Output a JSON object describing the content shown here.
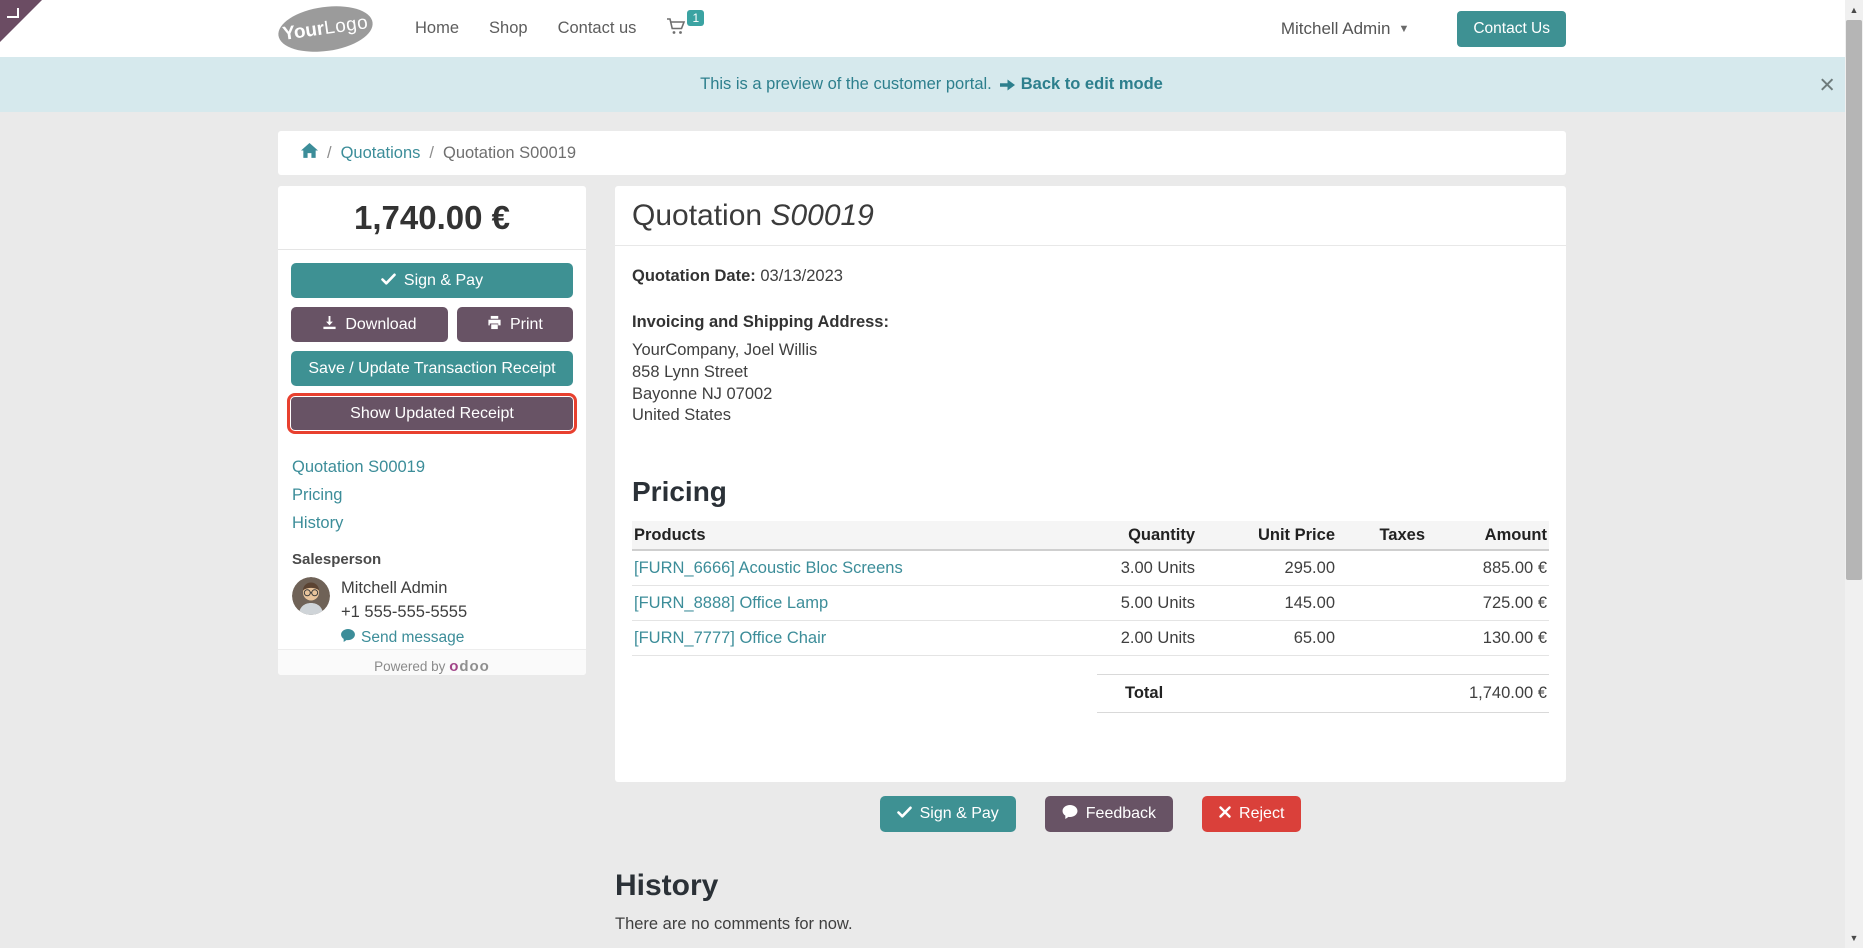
{
  "header": {
    "logo": {
      "bold": "Your",
      "light": "Logo"
    },
    "nav": [
      {
        "label": "Home"
      },
      {
        "label": "Shop"
      },
      {
        "label": "Contact us"
      }
    ],
    "cart_count": "1",
    "user_name": "Mitchell Admin",
    "contact_us": "Contact Us"
  },
  "banner": {
    "message": "This is a preview of the customer portal.",
    "link": "Back to edit mode",
    "close": "×"
  },
  "breadcrumb": {
    "parent": "Quotations",
    "current": "Quotation S00019"
  },
  "sidebar": {
    "amount": "1,740.00 €",
    "buttons": {
      "sign_pay": "Sign & Pay",
      "download": "Download",
      "print": "Print",
      "save_receipt": "Save / Update Transaction Receipt",
      "show_receipt": "Show Updated Receipt"
    },
    "links": [
      {
        "label": "Quotation S00019"
      },
      {
        "label": "Pricing"
      },
      {
        "label": "History"
      }
    ],
    "salesperson": {
      "label": "Salesperson",
      "name": "Mitchell Admin",
      "phone": "+1 555-555-5555",
      "send_message": "Send message"
    },
    "powered_by": {
      "prefix": "Powered by",
      "brand_first": "o",
      "brand_rest": "doo"
    }
  },
  "document": {
    "title": "Quotation",
    "reference": "S00019",
    "date_label": "Quotation Date:",
    "date": "03/13/2023",
    "address_label": "Invoicing and Shipping Address:",
    "address": [
      "YourCompany, Joel Willis",
      "858 Lynn Street",
      "Bayonne NJ 07002",
      "United States"
    ],
    "pricing": {
      "title": "Pricing",
      "headers": {
        "products": "Products",
        "quantity": "Quantity",
        "unit_price": "Unit Price",
        "taxes": "Taxes",
        "amount": "Amount"
      },
      "rows": [
        {
          "product": "[FURN_6666] Acoustic Bloc Screens",
          "quantity": "3.00 Units",
          "unit_price": "295.00",
          "taxes": "",
          "amount": "885.00 €"
        },
        {
          "product": "[FURN_8888] Office Lamp",
          "quantity": "5.00 Units",
          "unit_price": "145.00",
          "taxes": "",
          "amount": "725.00 €"
        },
        {
          "product": "[FURN_7777] Office Chair",
          "quantity": "2.00 Units",
          "unit_price": "65.00",
          "taxes": "",
          "amount": "130.00 €"
        }
      ],
      "total_label": "Total",
      "total": "1,740.00 €"
    }
  },
  "actions": {
    "sign_pay": "Sign & Pay",
    "feedback": "Feedback",
    "reject": "Reject"
  },
  "history": {
    "title": "History",
    "empty": "There are no comments for now."
  },
  "colors": {
    "teal": "#3e9193",
    "purple": "#685365",
    "danger": "#da403a",
    "highlight_border": "#e8402f",
    "link": "#3c8d99",
    "banner_bg": "#d6e9ed",
    "banner_text": "#2d7f8d",
    "ribbon": "#6b4c63"
  }
}
